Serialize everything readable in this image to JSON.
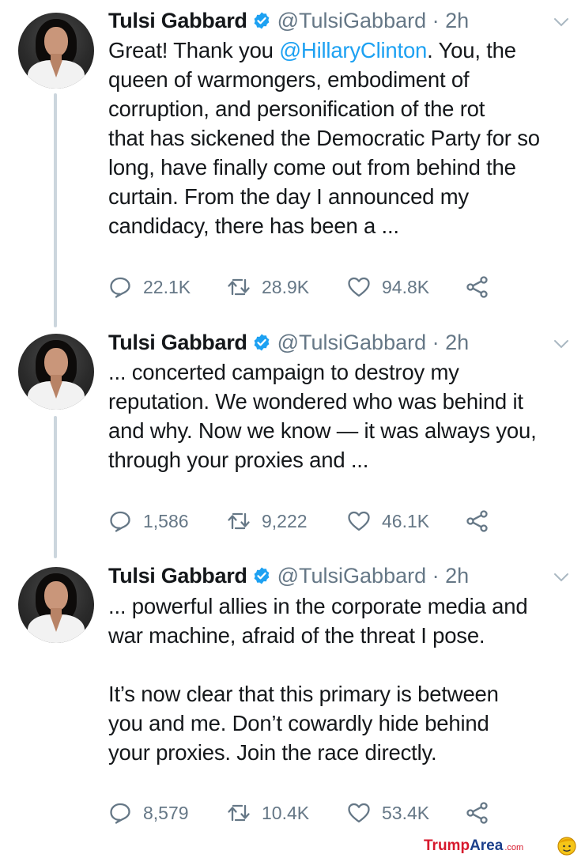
{
  "tweets": [
    {
      "name": "Tulsi Gabbard",
      "handle": "@TulsiGabbard",
      "sep": "·",
      "time": "2h",
      "text_lines": [
        [
          "Great! Thank you ",
          "@HillaryClinton",
          ". You, the"
        ],
        "queen of warmongers, embodiment of",
        "corruption, and personification of the rot",
        "that has sickened the Democratic Party for so",
        "long, have finally come out from behind the",
        "curtain. From the day I announced my",
        "candidacy, there has been a ..."
      ],
      "replies": "22.1K",
      "retweets": "28.9K",
      "likes": "94.8K"
    },
    {
      "name": "Tulsi Gabbard",
      "handle": "@TulsiGabbard",
      "sep": "·",
      "time": "2h",
      "text_lines": [
        "... concerted campaign to destroy my",
        "reputation. We wondered who was behind it",
        "and why. Now we know — it was always you,",
        "through your proxies and ..."
      ],
      "replies": "1,586",
      "retweets": "9,222",
      "likes": "46.1K"
    },
    {
      "name": "Tulsi Gabbard",
      "handle": "@TulsiGabbard",
      "sep": "·",
      "time": "2h",
      "text_lines": [
        "... powerful allies in the corporate media and",
        "war machine, afraid of the threat I pose.",
        "",
        "It’s now clear that this primary is between",
        "you and me. Don’t cowardly hide behind",
        "your proxies. Join the race directly."
      ],
      "replies": "8,579",
      "retweets": "10.4K",
      "likes": "53.4K"
    }
  ],
  "icons": {
    "verified": "verified-badge-icon",
    "chevron": "chevron-down-icon",
    "reply": "reply-icon",
    "retweet": "retweet-icon",
    "like": "heart-icon",
    "share": "share-icon"
  },
  "colors": {
    "verified": "#1da1f2",
    "mention": "#1da1f2",
    "muted": "#657786",
    "thread_line": "#ccd6dd"
  },
  "watermark": {
    "trump": "Trump",
    "area": "Area",
    "com": ".com"
  }
}
